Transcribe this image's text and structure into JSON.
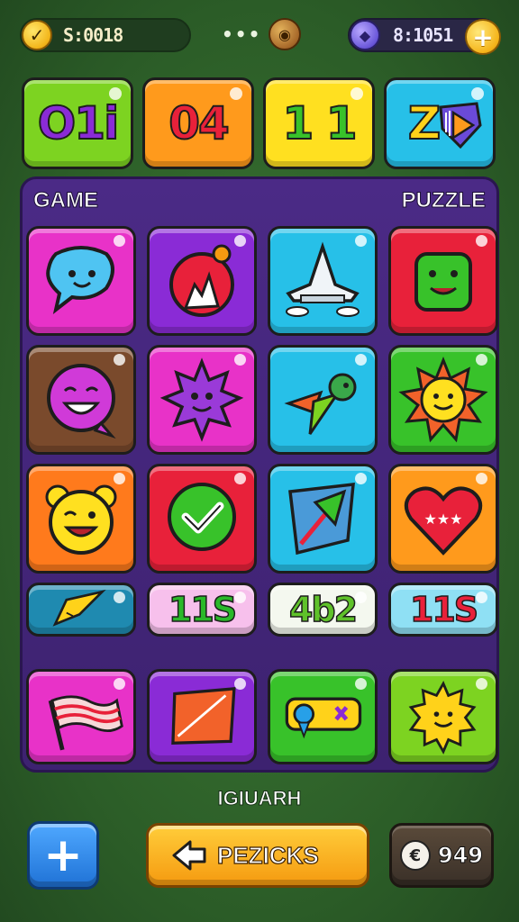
{
  "topbar": {
    "left_value": "S:0018",
    "dots": "•••",
    "right_value": "8:1051"
  },
  "scores": [
    {
      "text": "O1i",
      "bg": "#7dd321",
      "fg": "#8a2bd6"
    },
    {
      "text": "04",
      "bg": "#ff9a1c",
      "fg": "#e8213a"
    },
    {
      "text": "1 1",
      "bg": "#ffe020",
      "fg": "#38c22a"
    },
    {
      "text": "Z",
      "bg": "#27c0e8",
      "fg": "#ffd21a"
    }
  ],
  "board": {
    "left_label": "GAME",
    "right_label": "PUZZLE",
    "text_tiles": [
      {
        "text": "11S",
        "fg": "#2ab82a"
      },
      {
        "text": "4b2",
        "fg": "#5fc22a"
      },
      {
        "text": "11S",
        "fg": "#e8213a"
      }
    ]
  },
  "footer": {
    "label": "IGIUARH",
    "main_button": "PEZICKS",
    "coins": "949"
  }
}
